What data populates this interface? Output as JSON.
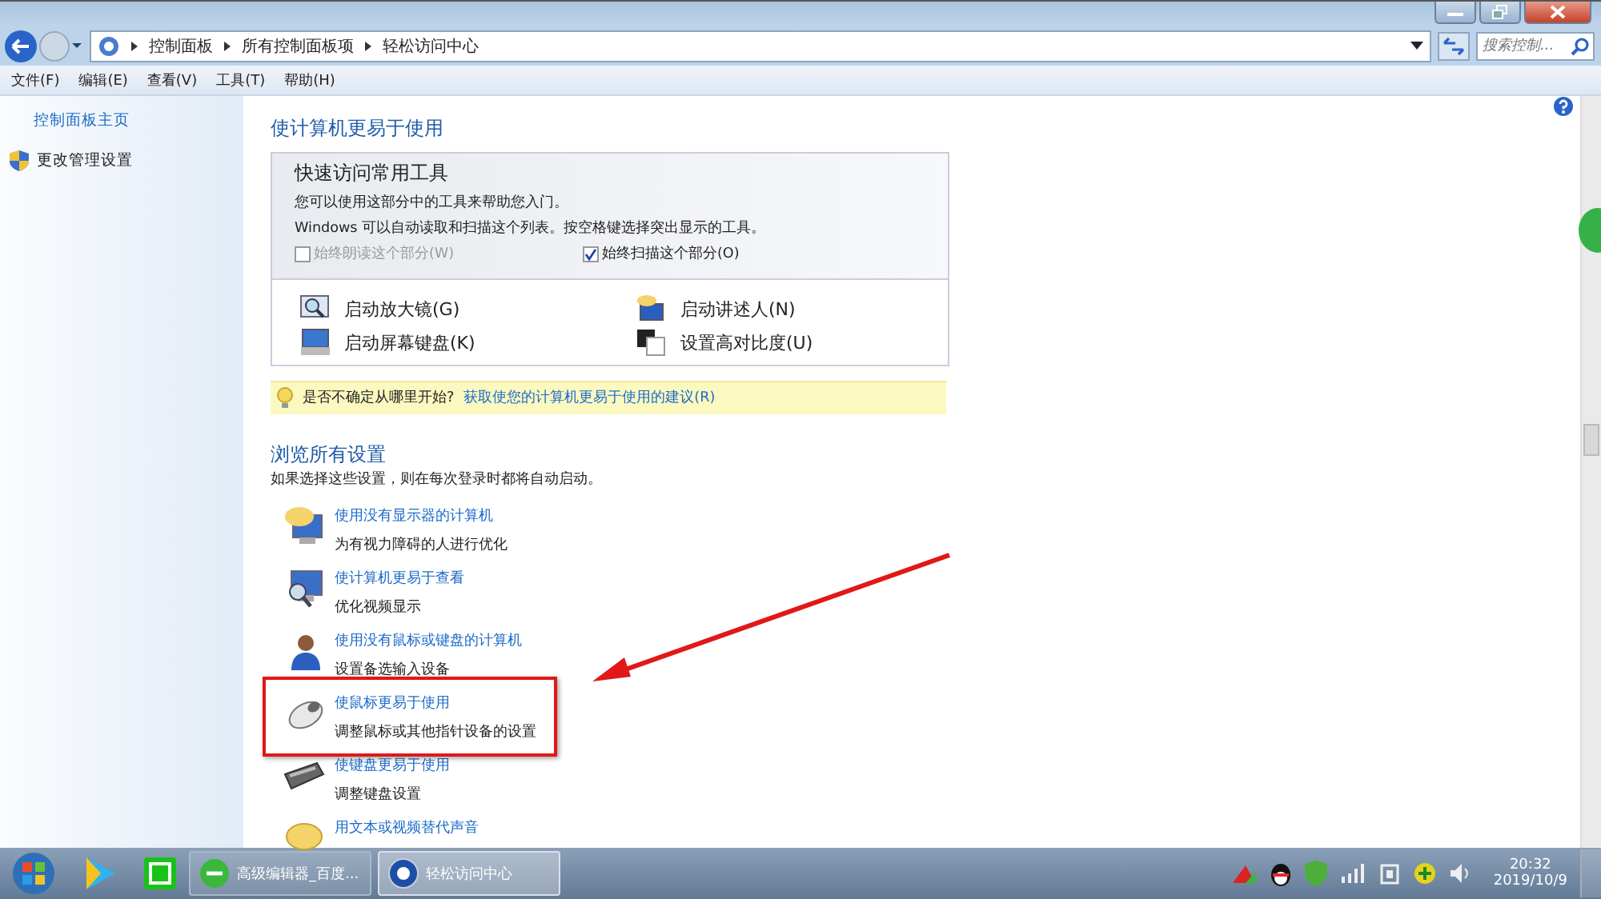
{
  "address_bar": {
    "breadcrumbs": [
      "控制面板",
      "所有控制面板项",
      "轻松访问中心"
    ]
  },
  "search": {
    "placeholder": "搜索控制..."
  },
  "menu": [
    "文件(F)",
    "编辑(E)",
    "查看(V)",
    "工具(T)",
    "帮助(H)"
  ],
  "sidebar": {
    "items": [
      {
        "label": "控制面板主页",
        "kind": "link"
      },
      {
        "label": "更改管理设置",
        "kind": "shield"
      }
    ]
  },
  "heading": "使计算机更易于使用",
  "quick_tools": {
    "title": "快速访问常用工具",
    "lines": [
      "您可以使用这部分中的工具来帮助您入门。",
      "Windows 可以自动读取和扫描这个列表。按空格键选择突出显示的工具。"
    ],
    "options": [
      {
        "label": "始终朗读这个部分(W)",
        "checked": false,
        "disabled": true
      },
      {
        "label": "始终扫描这个部分(O)",
        "checked": true,
        "disabled": false
      }
    ],
    "tools": [
      {
        "label": "启动放大镜(G)",
        "kind": "magnifier"
      },
      {
        "label": "启动讲述人(N)",
        "kind": "narrator"
      },
      {
        "label": "启动屏幕键盘(K)",
        "kind": "keyboard"
      },
      {
        "label": "设置高对比度(U)",
        "kind": "contrast"
      }
    ]
  },
  "tip": {
    "text": "是否不确定从哪里开始?",
    "link": "获取使您的计算机更易于使用的建议(R)"
  },
  "browse": {
    "title": "浏览所有设置",
    "subtitle": "如果选择这些设置，则在每次登录时都将自动启动。",
    "items": [
      {
        "title": "使用没有显示器的计算机",
        "desc": "为有视力障碍的人进行优化",
        "kind": "monitor"
      },
      {
        "title": "使计算机更易于查看",
        "desc": "优化视频显示",
        "kind": "view"
      },
      {
        "title": "使用没有鼠标或键盘的计算机",
        "desc": "设置备选输入设备",
        "kind": "person"
      },
      {
        "title": "使鼠标更易于使用",
        "desc": "调整鼠标或其他指针设备的设置",
        "kind": "mouse"
      },
      {
        "title": "使键盘更易于使用",
        "desc": "调整键盘设置",
        "kind": "keyboard"
      },
      {
        "title": "用文本或视频替代声音",
        "kind": "bubble"
      }
    ]
  },
  "taskbar": {
    "tasks": [
      {
        "label": "高级编辑器_百度...",
        "kind": "browser",
        "selected": false
      },
      {
        "label": "轻松访问中心",
        "kind": "ease",
        "selected": true
      }
    ],
    "time": "20:32",
    "date": "2019/10/9"
  }
}
